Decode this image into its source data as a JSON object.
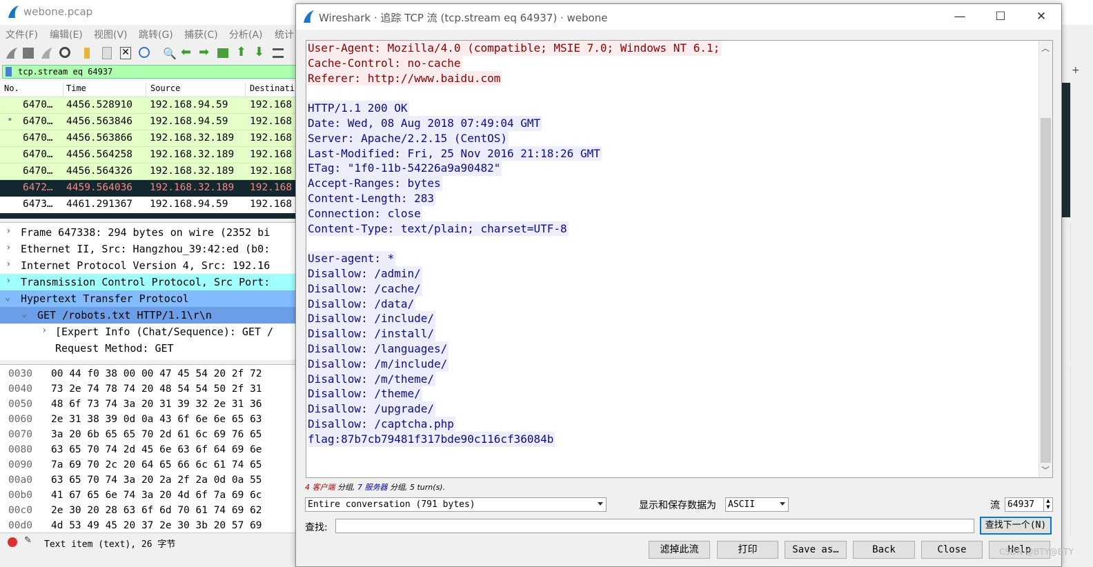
{
  "main": {
    "title": "webone.pcap",
    "menu": [
      "文件(F)",
      "编辑(E)",
      "视图(V)",
      "跳转(G)",
      "捕获(C)",
      "分析(A)",
      "统计"
    ],
    "filter": "tcp.stream eq 64937",
    "columns": [
      "No.",
      "Time",
      "Source",
      "Destinati"
    ],
    "packets": [
      {
        "no": "6470…",
        "time": "4456.528910",
        "src": "192.168.94.59",
        "dst": "192.168"
      },
      {
        "no": "6470…",
        "time": "4456.563846",
        "src": "192.168.94.59",
        "dst": "192.168"
      },
      {
        "no": "6470…",
        "time": "4456.563866",
        "src": "192.168.32.189",
        "dst": "192.168"
      },
      {
        "no": "6470…",
        "time": "4456.564258",
        "src": "192.168.32.189",
        "dst": "192.168"
      },
      {
        "no": "6470…",
        "time": "4456.564326",
        "src": "192.168.32.189",
        "dst": "192.168"
      },
      {
        "no": "6472…",
        "time": "4459.564036",
        "src": "192.168.32.189",
        "dst": "192.168"
      },
      {
        "no": "6473…",
        "time": "4461.291367",
        "src": "192.168.94.59",
        "dst": "192.168"
      }
    ],
    "details": [
      "Frame 647338: 294 bytes on wire (2352 bi",
      "Ethernet II, Src: Hangzhou_39:42:ed (b0:",
      "Internet Protocol Version 4, Src: 192.16",
      "Transmission Control Protocol, Src Port:",
      "Hypertext Transfer Protocol",
      "GET /robots.txt HTTP/1.1\\r\\n",
      "[Expert Info (Chat/Sequence): GET /",
      "Request Method: GET"
    ],
    "bytes": [
      {
        "off": "0030",
        "hex": "00 44 f0 38 00 00 47 45  54 20 2f 72"
      },
      {
        "off": "0040",
        "hex": "73 2e 74 78 74 20 48 54  54 50 2f 31"
      },
      {
        "off": "0050",
        "hex": "48 6f 73 74 3a 20 31 39  32 2e 31 36"
      },
      {
        "off": "0060",
        "hex": "2e 31 38 39 0d 0a 43 6f  6e 6e 65 63"
      },
      {
        "off": "0070",
        "hex": "3a 20 6b 65 65 70 2d 61  6c 69 76 65"
      },
      {
        "off": "0080",
        "hex": "63 65 70 74 2d 45 6e 63  6f 64 69 6e"
      },
      {
        "off": "0090",
        "hex": "7a 69 70 2c 20 64 65 66  6c 61 74 65"
      },
      {
        "off": "00a0",
        "hex": "63 65 70 74 3a 20 2a 2f  2a 0d 0a 55"
      },
      {
        "off": "00b0",
        "hex": "41 67 65 6e 74 3a 20 4d  6f 7a 69 6c"
      },
      {
        "off": "00c0",
        "hex": "2e 30 20 28 63 6f 6d 70  61 74 69 62"
      },
      {
        "off": "00d0",
        "hex": "4d 53 49 45 20 37 2e 30  3b 20 57 69"
      }
    ],
    "status": "Text item (text), 26 字节"
  },
  "dialog": {
    "title": "Wireshark · 追踪 TCP 流 (tcp.stream eq 64937) · webone",
    "client_lines": [
      "User-Agent: Mozilla/4.0 (compatible; MSIE 7.0; Windows NT 6.1;",
      "Cache-Control: no-cache",
      "Referer: http://www.baidu.com"
    ],
    "server_lines": [
      "HTTP/1.1 200 OK",
      "Date: Wed, 08 Aug 2018 07:49:04 GMT",
      "Server: Apache/2.2.15 (CentOS)",
      "Last-Modified: Fri, 25 Nov 2016 21:18:26 GMT",
      "ETag: \"1f0-11b-54226a9a90482\"",
      "Accept-Ranges: bytes",
      "Content-Length: 283",
      "Connection: close",
      "Content-Type: text/plain; charset=UTF-8",
      "",
      "User-agent: *",
      "Disallow: /admin/",
      "Disallow: /cache/",
      "Disallow: /data/",
      "Disallow: /include/",
      "Disallow: /install/",
      "Disallow: /languages/",
      "Disallow: /m/include/",
      "Disallow: /m/theme/",
      "Disallow: /theme/",
      "Disallow: /upgrade/",
      "Disallow: /captcha.php",
      "flag:87b7cb79481f317bde90c116cf36084b"
    ],
    "summary": {
      "client_count": "4",
      "client_label": "客户端",
      "text1": "分组,",
      "server_count": "7",
      "server_label": "服务器",
      "text2": "分组,",
      "turns": "5 turn(s)."
    },
    "conversation_select": "Entire conversation (791 bytes)",
    "show_as_label": "显示和保存数据为",
    "show_as_value": "ASCII",
    "stream_label": "流",
    "stream_value": "64937",
    "find_label": "查找:",
    "find_value": "",
    "find_next": "查找下一个(N)",
    "buttons": {
      "filter_out": "滤掉此流",
      "print": "打印",
      "save_as": "Save as…",
      "back": "Back",
      "close": "Close",
      "help": "Help"
    }
  },
  "colors": {
    "client_bg": "#fbeded",
    "client_fg": "#8b0000",
    "server_bg": "#ededfb",
    "server_fg": "#0b0b8b",
    "selected_row": "#12272e",
    "http_row": "#e4ffc7"
  },
  "watermark": "CSDN @BTY@BTY"
}
